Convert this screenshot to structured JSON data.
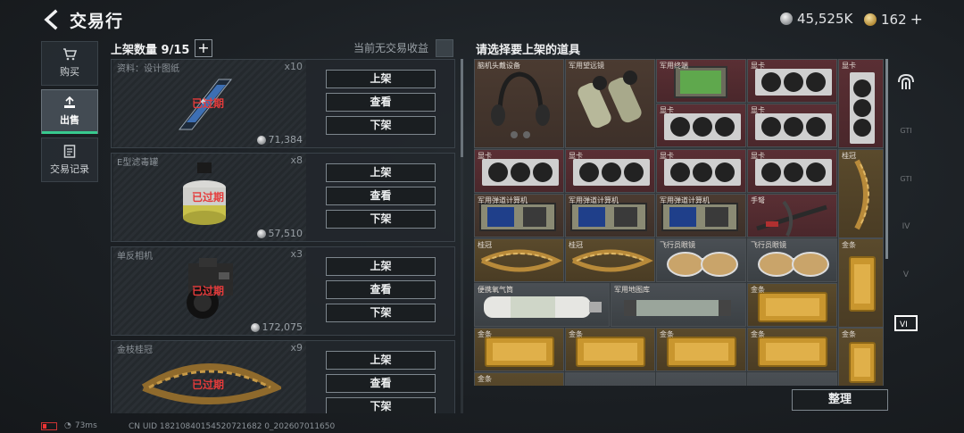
{
  "header": {
    "title": "交易行",
    "currency_silver": "45,525K",
    "currency_gold": "162",
    "currency_add": "+"
  },
  "nav": {
    "buy": "购买",
    "sell": "出售",
    "history": "交易记录"
  },
  "listing": {
    "slot_count": "上架数量 9/15",
    "plus": "+",
    "income_text": "当前无交易收益",
    "items": [
      {
        "name": "资料：设计图纸",
        "qty": "x10",
        "price": "71,384",
        "status": "已过期",
        "btn_list": "上架",
        "btn_view": "查看",
        "btn_remove": "下架"
      },
      {
        "name": "E型滤毒罐",
        "qty": "x8",
        "price": "57,510",
        "status": "已过期",
        "btn_list": "上架",
        "btn_view": "查看",
        "btn_remove": "下架"
      },
      {
        "name": "单反相机",
        "qty": "x3",
        "price": "172,075",
        "status": "已过期",
        "btn_list": "上架",
        "btn_view": "查看",
        "btn_remove": "下架"
      },
      {
        "name": "金枝桂冠",
        "qty": "x9",
        "price": "",
        "status": "已过期",
        "btn_list": "上架",
        "btn_view": "查看",
        "btn_remove": "下架"
      }
    ]
  },
  "inventory": {
    "title": "请选择要上架的道具",
    "rows": [
      [
        "脑机头戴设备",
        "军用望远镜",
        "军用终端",
        "显卡",
        "显卡"
      ],
      [
        "",
        "",
        "显卡",
        "显卡",
        ""
      ],
      [
        "显卡",
        "显卡",
        "显卡",
        "显卡",
        "桂冠"
      ],
      [
        "军用弹道计算机",
        "军用弹道计算机",
        "军用弹道计算机",
        "手弩",
        ""
      ],
      [
        "桂冠",
        "桂冠",
        "飞行员眼镜",
        "飞行员眼镜",
        "金条"
      ],
      [
        "便携氧气筒",
        "军用地图库",
        "",
        "金条",
        ""
      ],
      [
        "金条",
        "金条",
        "金条",
        "金条",
        "金条"
      ],
      [
        "金条",
        "",
        "",
        "",
        ""
      ]
    ],
    "sort_label": "整理",
    "filters": [
      "GTI",
      "GTI",
      "IV",
      "V",
      "VI",
      "GTI"
    ]
  },
  "status": {
    "ping": "73ms",
    "uid": "CN UID 18210840154520721682 0_202607011650"
  },
  "colors": {
    "accent_green": "#38c98f",
    "expired_red": "#e53b3b",
    "cell_red": "#5a2f34",
    "cell_brown": "#4b3b31",
    "cell_gold": "#5a4a2c"
  }
}
